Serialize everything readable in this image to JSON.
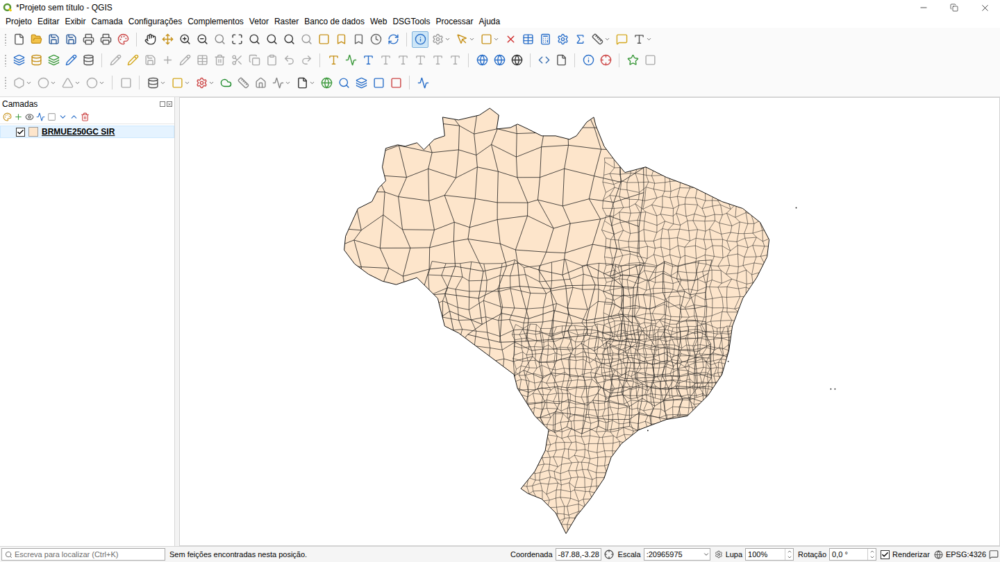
{
  "window": {
    "title": "*Projeto sem título - QGIS"
  },
  "menu": [
    "Projeto",
    "Editar",
    "Exibir",
    "Camada",
    "Configurações",
    "Complementos",
    "Vetor",
    "Raster",
    "Banco de dados",
    "Web",
    "DSGTools",
    "Processar",
    "Ajuda"
  ],
  "toolbar": {
    "identify_tool": {
      "selected": true
    }
  },
  "layers_panel": {
    "title": "Camadas",
    "layers": [
      {
        "name": "BRMUE250GC SIR",
        "visible": true,
        "selected": true
      }
    ]
  },
  "status_bar": {
    "search_placeholder": "Escreva para localizar (Ctrl+K)",
    "message": "Sem feições encontradas nesta posição.",
    "coordinate_label": "Coordenada",
    "coordinate": "-87.88,-3.28",
    "scale_label": "Escala",
    "scale": ":20965975",
    "magnifier_label": "Lupa",
    "magnifier": "100%",
    "rotation_label": "Rotação",
    "rotation": "0,0 °",
    "render_label": "Renderizar",
    "render": true,
    "crs": "EPSG:4326"
  }
}
